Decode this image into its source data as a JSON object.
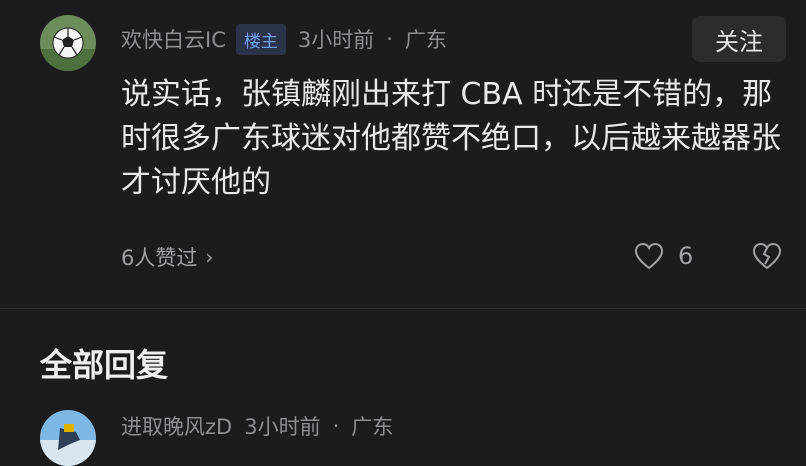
{
  "post": {
    "author": "欢快白云IC",
    "badge": "楼主",
    "time": "3小时前",
    "dot": "·",
    "location": "广东",
    "follow_label": "关注",
    "content": "说实话，张镇麟刚出来打 CBA 时还是不错的，那时很多广东球迷对他都赞不绝口，以后越来越器张才讨厌他的",
    "likers_label": "6人赞过",
    "likers_chevron": "›",
    "like_count": "6"
  },
  "replies": {
    "title": "全部回复",
    "first": {
      "author": "进取晚风zD",
      "time": "3小时前",
      "dot": "·",
      "location": "广东"
    }
  },
  "colors": {
    "background": "#1c1c1e",
    "badge_text": "#6f9cff",
    "muted": "#8e8e93"
  },
  "icons": [
    "soccer-ball-avatar",
    "heart-icon",
    "broken-heart-icon",
    "chevron-right-icon"
  ]
}
